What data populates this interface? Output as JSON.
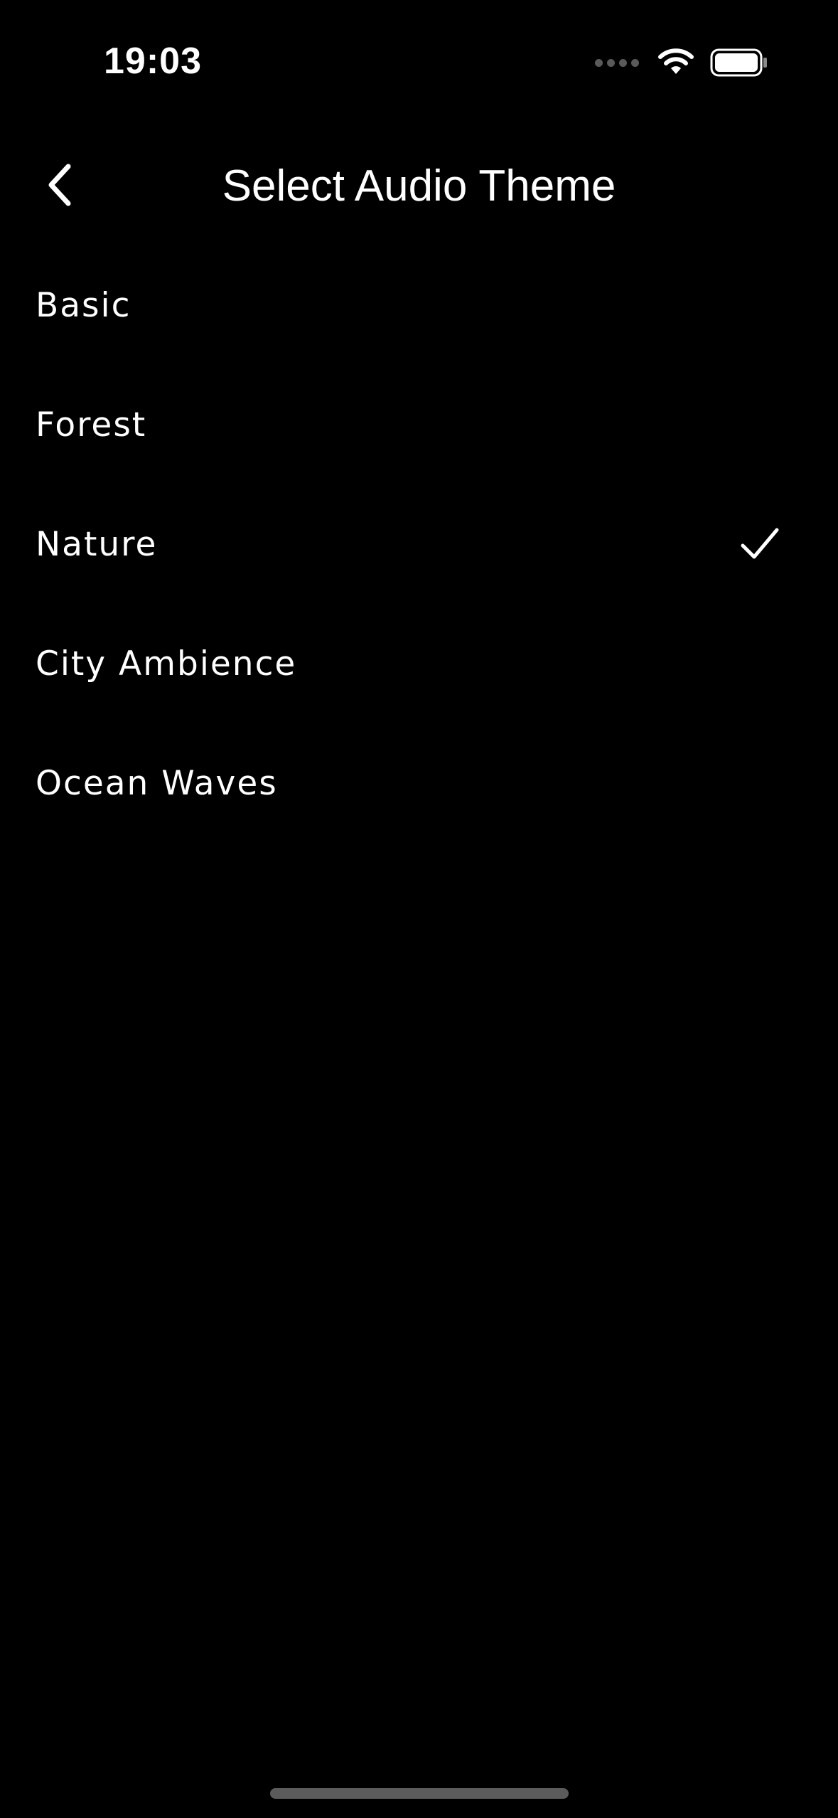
{
  "status_bar": {
    "time": "19:03",
    "signal_icon": "cellular-signal-dots",
    "wifi_icon": "wifi-icon",
    "battery_icon": "battery-full-icon"
  },
  "header": {
    "title": "Select Audio Theme",
    "back_icon": "chevron-left-icon"
  },
  "themes": {
    "items": [
      {
        "label": "Basic",
        "selected": false
      },
      {
        "label": "Forest",
        "selected": false
      },
      {
        "label": "Nature",
        "selected": true
      },
      {
        "label": "City Ambience",
        "selected": false
      },
      {
        "label": "Ocean Waves",
        "selected": false
      }
    ],
    "check_icon": "checkmark-icon"
  },
  "colors": {
    "background": "#000000",
    "text": "#ffffff",
    "muted": "#5a5a5a"
  }
}
